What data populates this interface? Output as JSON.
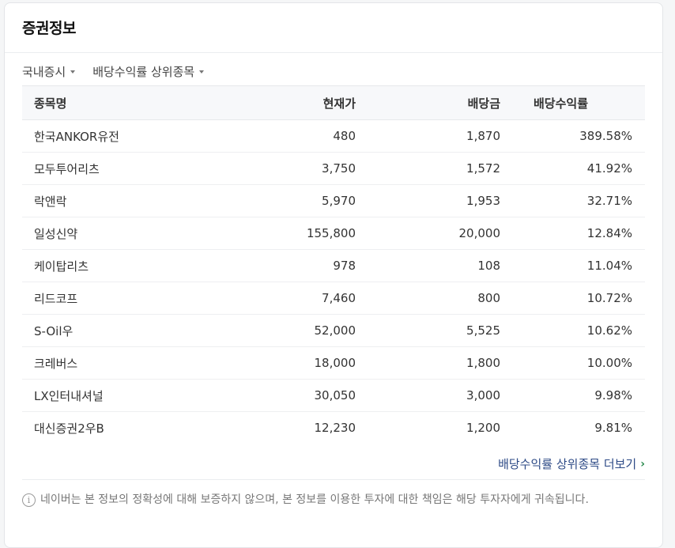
{
  "card": {
    "title": "증권정보"
  },
  "filters": {
    "market": "국내증시",
    "ranking": "배당수익률 상위종목"
  },
  "table": {
    "headers": {
      "name": "종목명",
      "price": "현재가",
      "dividend": "배당금",
      "yield": "배당수익률"
    },
    "rows": [
      {
        "name": "한국ANKOR유전",
        "price": "480",
        "dividend": "1,870",
        "yield": "389.58%"
      },
      {
        "name": "모두투어리츠",
        "price": "3,750",
        "dividend": "1,572",
        "yield": "41.92%"
      },
      {
        "name": "락앤락",
        "price": "5,970",
        "dividend": "1,953",
        "yield": "32.71%"
      },
      {
        "name": "일성신약",
        "price": "155,800",
        "dividend": "20,000",
        "yield": "12.84%"
      },
      {
        "name": "케이탑리츠",
        "price": "978",
        "dividend": "108",
        "yield": "11.04%"
      },
      {
        "name": "리드코프",
        "price": "7,460",
        "dividend": "800",
        "yield": "10.72%"
      },
      {
        "name": "S-Oil우",
        "price": "52,000",
        "dividend": "5,525",
        "yield": "10.62%"
      },
      {
        "name": "크레버스",
        "price": "18,000",
        "dividend": "1,800",
        "yield": "10.00%"
      },
      {
        "name": "LX인터내셔널",
        "price": "30,050",
        "dividend": "3,000",
        "yield": "9.98%"
      },
      {
        "name": "대신증권2우B",
        "price": "12,230",
        "dividend": "1,200",
        "yield": "9.81%"
      }
    ]
  },
  "more_link": {
    "label": "배당수익률 상위종목 더보기",
    "chevron": "›"
  },
  "notice": {
    "icon": "i",
    "text": "네이버는 본 정보의 정확성에 대해 보증하지 않으며, 본 정보를 이용한 투자에 대한 책임은 해당 투자자에게 귀속됩니다."
  },
  "colors": {
    "link": "#2d4a86",
    "chevron_accent": "#2a8a4e"
  }
}
